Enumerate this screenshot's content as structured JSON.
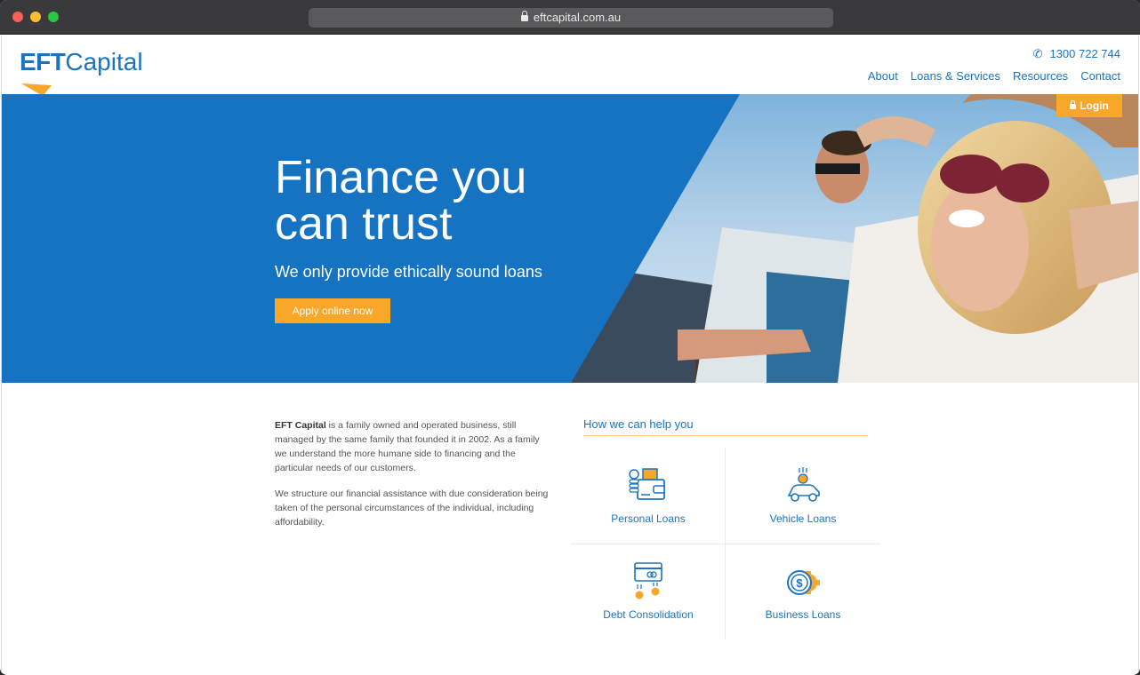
{
  "browser": {
    "url": "eftcapital.com.au"
  },
  "header": {
    "logo_bold": "EFT",
    "logo_light": "Capital",
    "phone": "1300 722 744",
    "nav": [
      "About",
      "Loans & Services",
      "Resources",
      "Contact"
    ],
    "login_label": "Login"
  },
  "hero": {
    "title": "Finance you can trust",
    "subtitle": "We only provide ethically sound loans",
    "cta_label": "Apply online now"
  },
  "about": {
    "brand": "EFT Capital",
    "para1_rest": " is a family owned and operated business, still managed by the same family that founded it in 2002. As a family we understand the more humane side to financing and the particular needs of our customers.",
    "para2": "We structure our financial assistance with due consideration being taken of the personal circumstances of the individual, including affordability."
  },
  "help": {
    "title": "How we can help you",
    "items": [
      {
        "label": "Personal Loans",
        "icon": "wallet-coins-icon"
      },
      {
        "label": "Vehicle Loans",
        "icon": "car-dollar-icon"
      },
      {
        "label": "Debt Consolidation",
        "icon": "card-coins-icon"
      },
      {
        "label": "Business Loans",
        "icon": "dollar-gear-icon"
      }
    ]
  },
  "colors": {
    "brand_blue": "#1b74c0",
    "accent_orange": "#f9a72a"
  }
}
